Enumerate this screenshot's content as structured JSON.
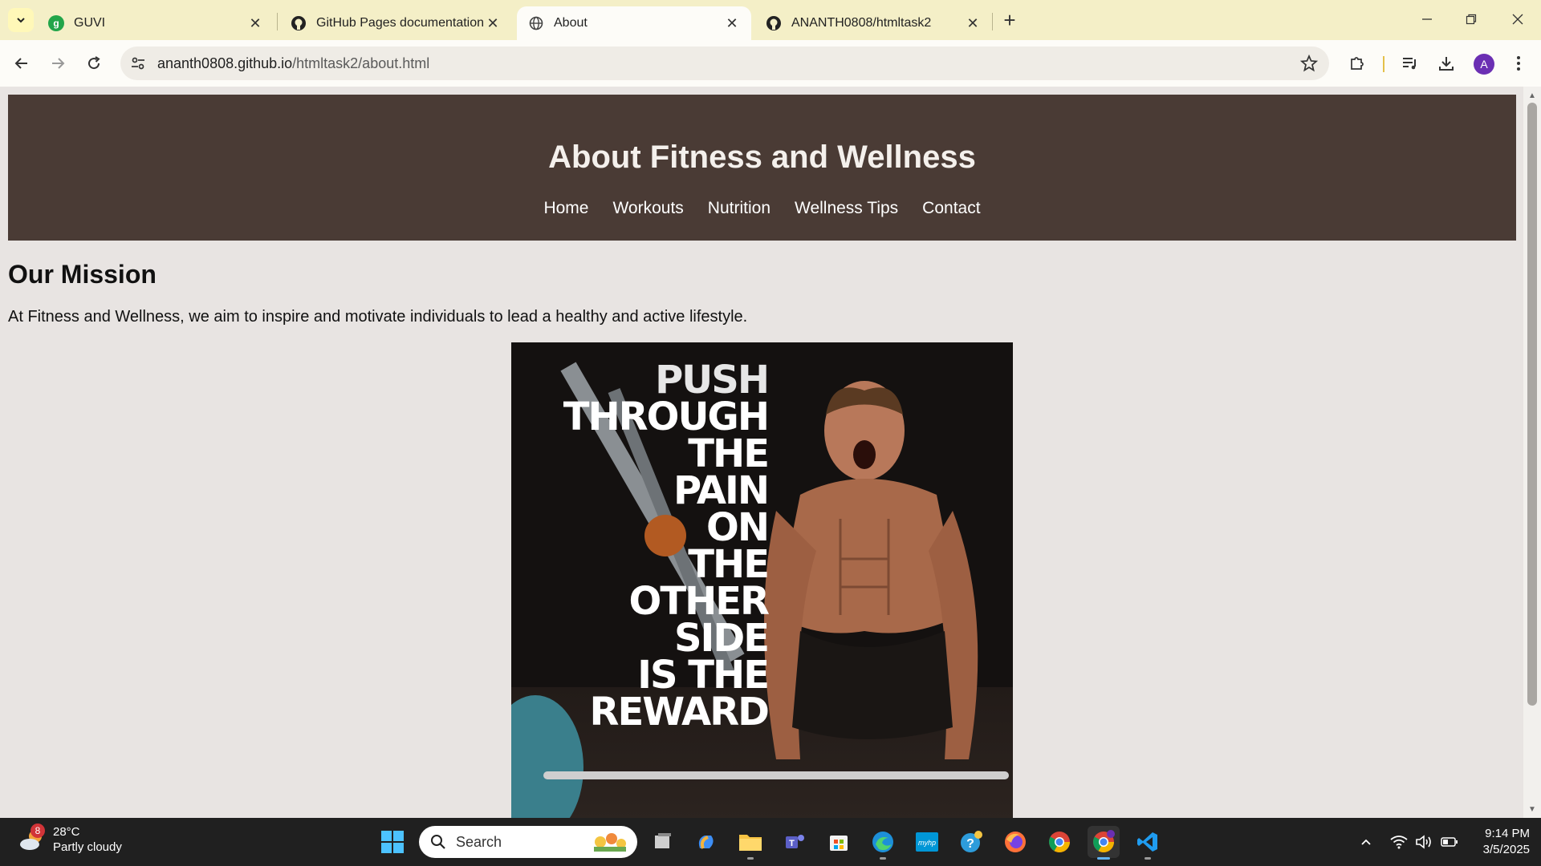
{
  "browser": {
    "tabs": [
      {
        "title": "GUVI",
        "icon": "guvi-icon",
        "active": false
      },
      {
        "title": "GitHub Pages documentation -",
        "icon": "github-icon",
        "active": false
      },
      {
        "title": "About",
        "icon": "globe-icon",
        "active": true
      },
      {
        "title": "ANANTH0808/htmltask2",
        "icon": "github-icon",
        "active": false
      }
    ],
    "url_host": "ananth0808.github.io",
    "url_path": "/htmltask2/about.html",
    "profile_initial": "A",
    "guvi_badge": "g"
  },
  "page": {
    "header_title": "About Fitness and Wellness",
    "nav": [
      "Home",
      "Workouts",
      "Nutrition",
      "Wellness Tips",
      "Contact"
    ],
    "mission_heading": "Our Mission",
    "mission_text": "At Fitness and Wellness, we aim to inspire and motivate individuals to lead a healthy and active lifestyle.",
    "poster_quote": [
      "PUSH",
      "THROUGH",
      "THE",
      "PAIN",
      "ON",
      "THE",
      "OTHER",
      "SIDE",
      "IS THE",
      "REWARD"
    ]
  },
  "taskbar": {
    "weather_badge": "8",
    "temperature": "28°C",
    "weather_desc": "Partly cloudy",
    "search_label": "Search",
    "time": "9:14 PM",
    "date": "3/5/2025"
  },
  "colors": {
    "header_bg": "#4a3b35",
    "page_bg": "#e8e4e2",
    "tabstrip_bg": "#f4efc7"
  }
}
